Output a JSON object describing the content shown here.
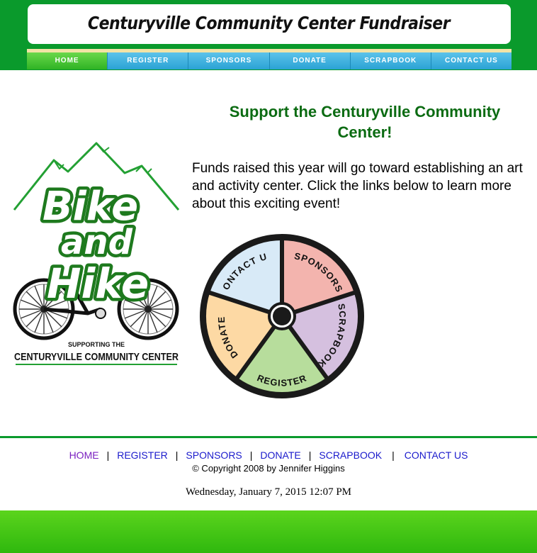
{
  "header": {
    "title": "Centuryville Community Center Fundraiser"
  },
  "nav": {
    "items": [
      {
        "label": "HOME",
        "active": true
      },
      {
        "label": "REGISTER",
        "active": false
      },
      {
        "label": "SPONSORS",
        "active": false
      },
      {
        "label": "DONATE",
        "active": false
      },
      {
        "label": "SCRAPBOOK",
        "active": false
      },
      {
        "label": "CONTACT US",
        "active": false
      }
    ]
  },
  "logo": {
    "line1": "Bike",
    "line2": "and",
    "line3": "Hike",
    "supporting": "SUPPORTING THE",
    "org": "CENTURYVILLE COMMUNITY CENTER"
  },
  "main": {
    "heading": "Support the Centuryville Community Center!",
    "intro": "Funds raised this year will go toward establishing an art and activity center. Click the links below to learn more about this exciting event!"
  },
  "wheel": {
    "segments": [
      {
        "label": "SPONSORS",
        "color": "#f3b4ae"
      },
      {
        "label": "SCRAPBOOK",
        "color": "#d5c0df"
      },
      {
        "label": "REGISTER",
        "color": "#b7dd9c"
      },
      {
        "label": "DONATE",
        "color": "#fdd9a4"
      },
      {
        "label": "CONTACT US",
        "color": "#d8eaf7"
      }
    ]
  },
  "footer": {
    "links": [
      "HOME",
      "REGISTER",
      "SPONSORS",
      "DONATE",
      "SCRAPBOOK",
      "CONTACT US"
    ],
    "separator": "|",
    "copyright": "© Copyright 2008 by Jennifer Higgins",
    "datetime": "Wednesday, January 7, 2015 12:07 PM"
  },
  "colors": {
    "brand_green": "#0a9a2c",
    "heading_green": "#0b6b12",
    "nav_blue": "#2aa2d4",
    "nav_active_green": "#2fb324",
    "link_blue": "#1a1acc",
    "link_visited": "#7a1fc0"
  }
}
